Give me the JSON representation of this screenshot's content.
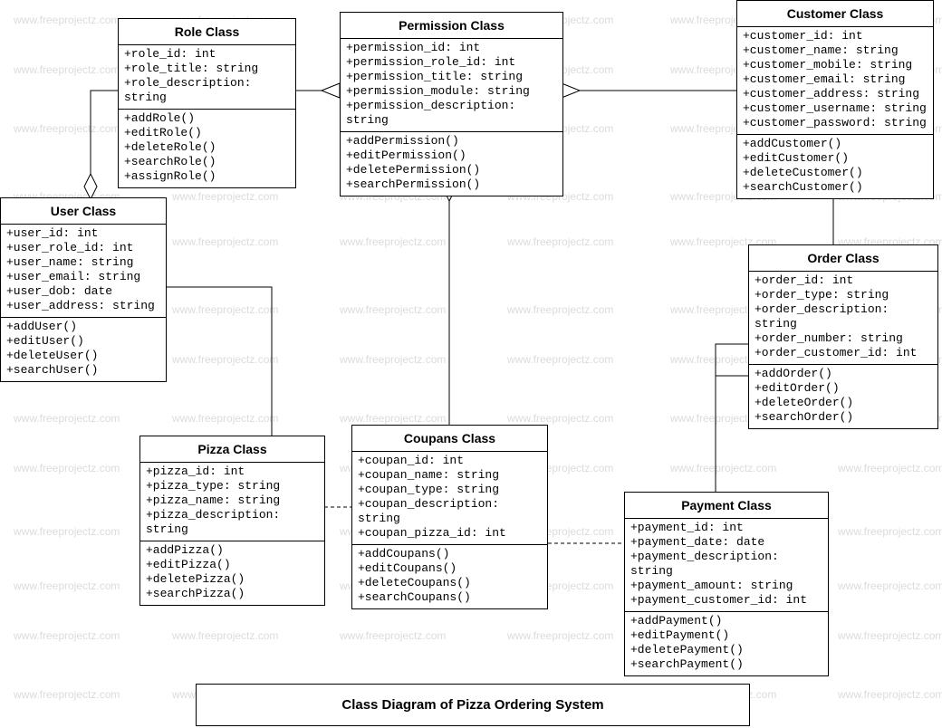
{
  "diagram_title": "Class Diagram of Pizza Ordering System",
  "watermark_text": "www.freeprojectz.com",
  "classes": {
    "role": {
      "name": "Role Class",
      "attrs": [
        "+role_id: int",
        "+role_title: string",
        "+role_description: string"
      ],
      "ops": [
        "+addRole()",
        "+editRole()",
        "+deleteRole()",
        "+searchRole()",
        "+assignRole()"
      ]
    },
    "permission": {
      "name": "Permission Class",
      "attrs": [
        "+permission_id: int",
        "+permission_role_id: int",
        "+permission_title: string",
        "+permission_module: string",
        "+permission_description: string"
      ],
      "ops": [
        "+addPermission()",
        "+editPermission()",
        "+deletePermission()",
        "+searchPermission()"
      ]
    },
    "customer": {
      "name": "Customer Class",
      "attrs": [
        "+customer_id: int",
        "+customer_name: string",
        "+customer_mobile: string",
        "+customer_email: string",
        "+customer_address: string",
        "+customer_username: string",
        "+customer_password: string"
      ],
      "ops": [
        "+addCustomer()",
        "+editCustomer()",
        "+deleteCustomer()",
        "+searchCustomer()"
      ]
    },
    "user": {
      "name": "User Class",
      "attrs": [
        "+user_id: int",
        "+user_role_id: int",
        "+user_name: string",
        "+user_email: string",
        "+user_dob: date",
        "+user_address: string"
      ],
      "ops": [
        "+addUser()",
        "+editUser()",
        "+deleteUser()",
        "+searchUser()"
      ]
    },
    "order": {
      "name": "Order Class",
      "attrs": [
        "+order_id: int",
        "+order_type: string",
        "+order_description: string",
        "+order_number: string",
        "+order_customer_id: int"
      ],
      "ops": [
        "+addOrder()",
        "+editOrder()",
        "+deleteOrder()",
        "+searchOrder()"
      ]
    },
    "pizza": {
      "name": "Pizza Class",
      "attrs": [
        "+pizza_id: int",
        "+pizza_type: string",
        "+pizza_name: string",
        "+pizza_description: string"
      ],
      "ops": [
        "+addPizza()",
        "+editPizza()",
        "+deletePizza()",
        "+searchPizza()"
      ]
    },
    "coupans": {
      "name": "Coupans  Class",
      "attrs": [
        "+coupan_id: int",
        "+coupan_name: string",
        "+coupan_type: string",
        "+coupan_description: string",
        "+coupan_pizza_id: int"
      ],
      "ops": [
        "+addCoupans()",
        "+editCoupans()",
        "+deleteCoupans()",
        "+searchCoupans()"
      ]
    },
    "payment": {
      "name": "Payment Class",
      "attrs": [
        "+payment_id: int",
        "+payment_date: date",
        "+payment_description: string",
        "+payment_amount: string",
        "+payment_customer_id: int"
      ],
      "ops": [
        "+addPayment()",
        "+editPayment()",
        "+deletePayment()",
        "+searchPayment()"
      ]
    }
  }
}
